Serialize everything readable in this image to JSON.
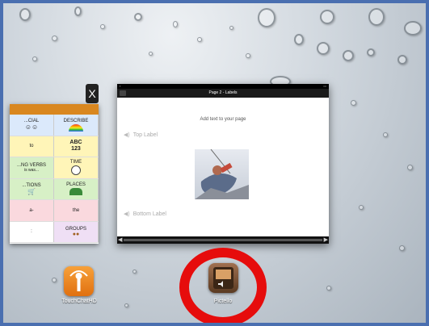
{
  "left_card": {
    "close_glyph": "X",
    "rows": [
      [
        {
          "text": "...CIAL",
          "color": "blue",
          "icon": "faces-icon"
        },
        {
          "text": "DESCRIBE",
          "color": "blue",
          "icon": "rainbow-icon"
        }
      ],
      [
        {
          "text": "to",
          "color": "yellow"
        },
        {
          "text": "ABC\n123",
          "color": "yellow",
          "icon": ""
        }
      ],
      [
        {
          "text": "...NG VERBS",
          "sub": "is was...",
          "color": "green"
        },
        {
          "text": "TIME",
          "color": "yellow",
          "icon": "clock-icon"
        }
      ],
      [
        {
          "text": "...TIONS",
          "color": "green",
          "icon": "cart-icon"
        },
        {
          "text": "PLACES",
          "color": "green",
          "icon": "park-icon"
        }
      ],
      [
        {
          "text": "a-",
          "color": "pink"
        },
        {
          "text": "the",
          "color": "pink"
        }
      ],
      [
        {
          "text": ":",
          "color": "white"
        },
        {
          "text": "GROUPS",
          "color": "purple",
          "icon": "group-icon"
        }
      ]
    ]
  },
  "center_card": {
    "nav_title": "Page 2 - Labels",
    "hint": "Add text to your page",
    "top_label": "Top Label",
    "bottom_label": "Bottom Label"
  },
  "dock": {
    "app1_label": "TouchChatHD",
    "app2_label": "Pictello"
  },
  "colors": {
    "frame_border": "#4a6fb0",
    "highlight_ring": "#e60c0c",
    "touchchat_orange": "#f08a1e"
  }
}
